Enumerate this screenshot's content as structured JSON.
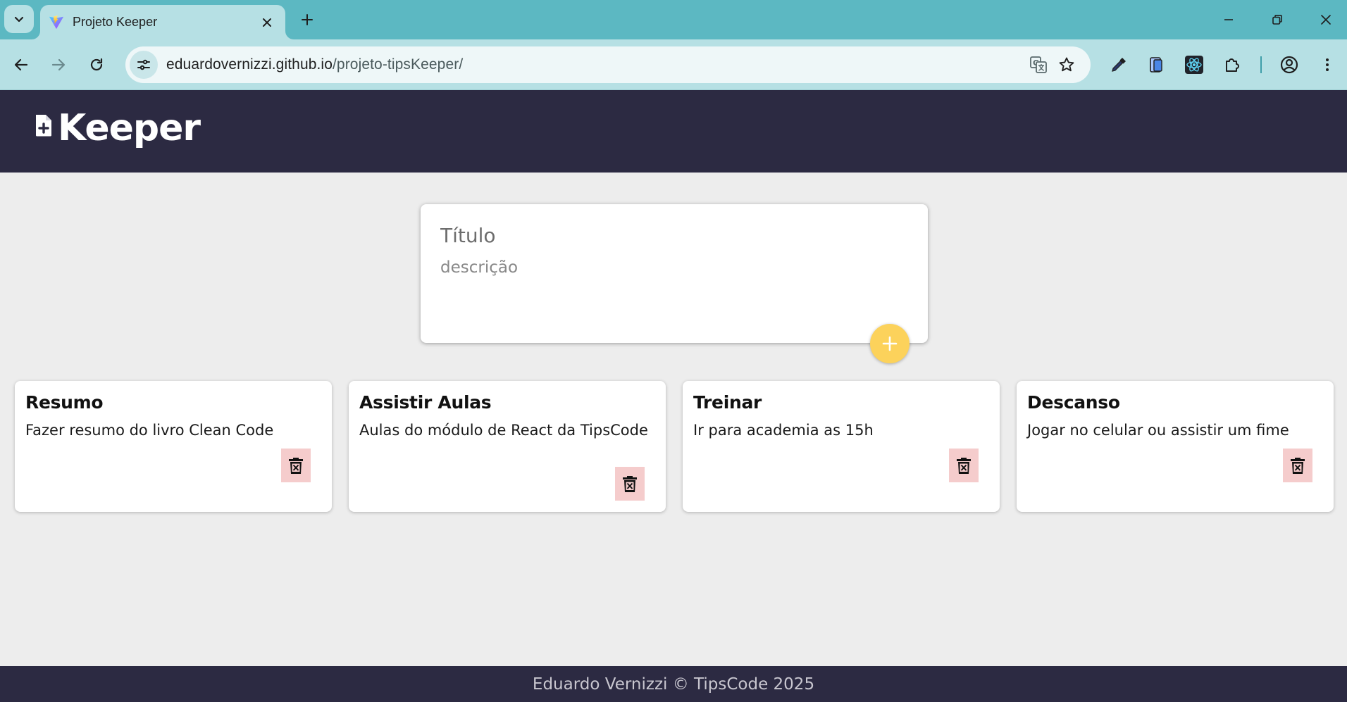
{
  "browser": {
    "tab": {
      "title": "Projeto Keeper",
      "favicon": "vite-logo-icon"
    },
    "address_bar": {
      "host": "eduardovernizzi.github.io",
      "path": "/projeto-tipsKeeper/"
    },
    "colors": {
      "tabbar": "#5cb8c2",
      "toolbar": "#b6e0e4"
    }
  },
  "app": {
    "brand": "Keeper",
    "create_note": {
      "title_placeholder": "Título",
      "description_placeholder": "descrição",
      "add_button_color": "#fcd25b"
    },
    "notes": [
      {
        "title": "Resumo",
        "content": "Fazer resumo do livro Clean Code"
      },
      {
        "title": "Assistir Aulas",
        "content": "Aulas do módulo de React da TipsCode"
      },
      {
        "title": "Treinar",
        "content": "Ir para academia as 15h"
      },
      {
        "title": "Descanso",
        "content": "Jogar no celular ou assistir um fime"
      }
    ],
    "footer": "Eduardo Vernizzi © TipsCode 2025",
    "colors": {
      "header_bg": "#2c2a42",
      "page_bg": "#ededed",
      "delete_bg": "#f5cccc"
    }
  }
}
